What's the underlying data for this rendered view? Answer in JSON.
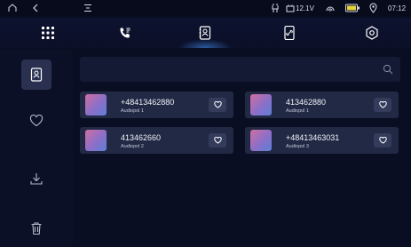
{
  "status_bar": {
    "voltage": "12.1V",
    "time": "07:12"
  },
  "top_nav": {
    "tabs": [
      {
        "icon": "apps-grid-icon"
      },
      {
        "icon": "phone-call-icon"
      },
      {
        "icon": "contacts-book-icon",
        "active": true
      },
      {
        "icon": "phone-link-icon"
      },
      {
        "icon": "settings-hex-icon"
      }
    ]
  },
  "sidebar": {
    "items": [
      {
        "icon": "contacts-icon",
        "active": true
      },
      {
        "icon": "heart-icon"
      },
      {
        "icon": "download-icon"
      },
      {
        "icon": "trash-icon"
      }
    ]
  },
  "search": {
    "placeholder": ""
  },
  "contacts": [
    {
      "number": "+48413462880",
      "device": "Audiopol  1"
    },
    {
      "number": "413462880",
      "device": "Audiopol  1"
    },
    {
      "number": "413462660",
      "device": "Audiopol  2"
    },
    {
      "number": "+48413463031",
      "device": "Audiopol 3"
    }
  ],
  "colors": {
    "background": "#0a0e22",
    "card": "#222945",
    "accent_glow": "#4696ff"
  }
}
